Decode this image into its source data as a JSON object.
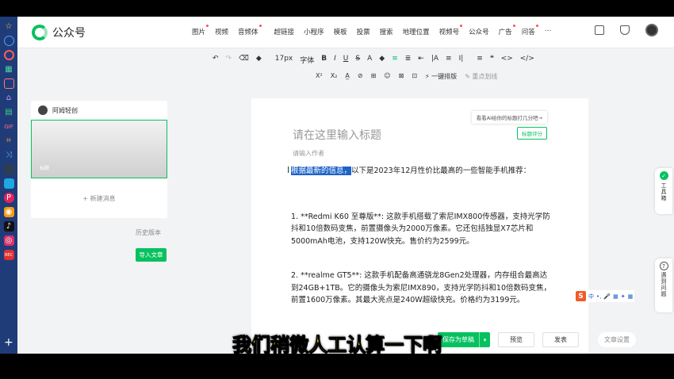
{
  "app": {
    "logo_text": "公众号",
    "brand_color": "#07c160",
    "accent_color": "#1e63c8"
  },
  "dock": {
    "items": [
      "star-icon",
      "clock-icon",
      "record-icon",
      "apps-icon",
      "box-icon",
      "home-icon",
      "doc-icon",
      "gif-icon",
      "crop-icon",
      "shuffle-icon",
      "dark-icon",
      "tv-icon",
      "pinterest-icon",
      "media-icon",
      "tiktok-icon",
      "instagram-icon",
      "recorder-icon"
    ],
    "gif_label": "GIF",
    "add_label": "+"
  },
  "nav": {
    "items": [
      "图片",
      "视频",
      "音频体",
      "超链接",
      "小程序",
      "模板",
      "投票",
      "搜索",
      "地理位置",
      "视频号",
      "公众号",
      "广告",
      "问答",
      "⋯"
    ]
  },
  "toolbar": {
    "row1": [
      "↶",
      "↷",
      "⌫",
      "◆",
      "17px",
      "字体",
      "B",
      "I",
      "U",
      "S",
      "A",
      "◆",
      "≡",
      "≣",
      "⇤",
      "|A",
      "≡",
      "I|",
      "≡",
      "❝",
      "<>",
      "</>"
    ],
    "row2": [
      "X²",
      "X₂",
      "A̲",
      "⊘",
      "⊞",
      "☺",
      "⊠",
      "⊡",
      "⚡ 一键排版",
      "✎ 重点划线"
    ]
  },
  "article_panel": {
    "account_name": "阿姆轻创",
    "thumb_label": "标题",
    "new_message_label": "+ 新建消息",
    "history_label": "历史版本",
    "import_label": "导入文章"
  },
  "editor": {
    "ai_tip": "看看AI给你的标题打几分吧→",
    "score_button": "标题评分",
    "title_placeholder": "请在这里输入标题",
    "author_placeholder": "请输入作者",
    "paragraph1_highlight": "根据最新的信息，",
    "paragraph1_rest": "以下是2023年12月性价比最高的一些智能手机推荐：",
    "paragraph2": "1. **Redmi K60 至尊版**: 这款手机搭载了索尼IMX800传感器，支持光学防抖和10倍数码变焦，前置摄像头为2000万像素。它还包括独显X7芯片和5000mAh电池，支持120W快充。售价约为2599元。",
    "paragraph3": "2. **realme GT5**: 这款手机配备高通骁龙8Gen2处理器，内存组合最高达到24GB+1TB。它的摄像头为索尼IMX890，支持光学防抖和10倍数码变焦，前置1600万像素。其最大亮点是240W超级快充。价格约为3199元。"
  },
  "actions": {
    "save_label": "保存为草稿",
    "preview_label": "预览",
    "publish_label": "发表",
    "doc_settings_label": "文章设置"
  },
  "side_widgets": {
    "toolbox_label": "工具箱",
    "help_label": "遇到问题",
    "ime_label": "中"
  },
  "subtitle": "我们稍微人工认算一下啊"
}
